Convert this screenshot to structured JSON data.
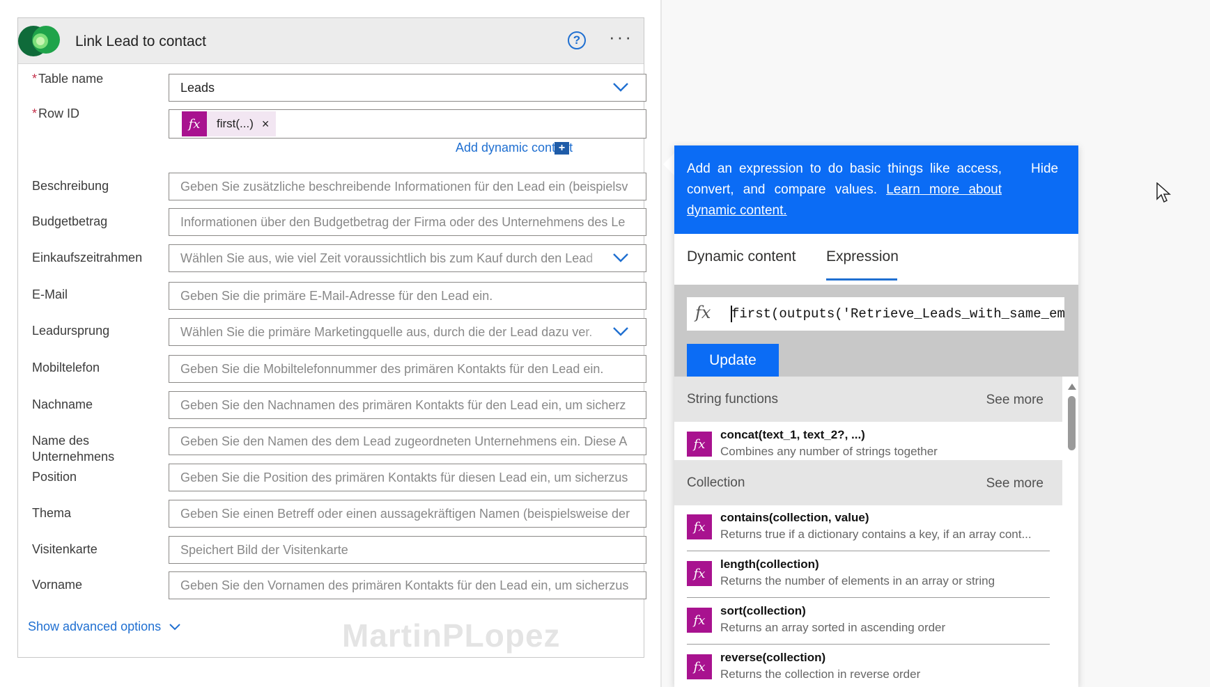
{
  "card": {
    "title": "Link Lead to contact",
    "help_icon": "help-circle-icon",
    "more_icon": "more-ellipsis-icon"
  },
  "fields": {
    "table_name": {
      "label": "Table name",
      "value": "Leads"
    },
    "row_id": {
      "label": "Row ID",
      "token": "first(...)",
      "token_close": "×"
    },
    "add_dynamic": {
      "label": "Add dynamic content",
      "icon": "+"
    },
    "beschreibung": {
      "label": "Beschreibung",
      "placeholder": "Geben Sie zusätzliche beschreibende Informationen für den Lead ein (beispielsv"
    },
    "budgetbetrag": {
      "label": "Budgetbetrag",
      "placeholder": "Informationen über den Budgetbetrag der Firma oder des Unternehmens des Le"
    },
    "einkaufszeitrahmen": {
      "label": "Einkaufszeitrahmen",
      "placeholder": "Wählen Sie aus, wie viel Zeit voraussichtlich bis zum Kauf durch den Lead"
    },
    "email": {
      "label": "E-Mail",
      "placeholder": "Geben Sie die primäre E-Mail-Adresse für den Lead ein."
    },
    "leadursprung": {
      "label": "Leadursprung",
      "placeholder": "Wählen Sie die primäre Marketingquelle aus, durch die der Lead dazu ver."
    },
    "mobiltelefon": {
      "label": "Mobiltelefon",
      "placeholder": "Geben Sie die Mobiltelefonnummer des primären Kontakts für den Lead ein."
    },
    "nachname": {
      "label": "Nachname",
      "placeholder": "Geben Sie den Nachnamen des primären Kontakts für den Lead ein, um sicherz"
    },
    "name_des_unternehmens": {
      "label": "Name des Unternehmens",
      "placeholder": "Geben Sie den Namen des dem Lead zugeordneten Unternehmens ein. Diese A"
    },
    "position": {
      "label": "Position",
      "placeholder": "Geben Sie die Position des primären Kontakts für diesen Lead ein, um sicherzus"
    },
    "thema": {
      "label": "Thema",
      "placeholder": "Geben Sie einen Betreff oder einen aussagekräftigen Namen (beispielsweise der"
    },
    "visitenkarte": {
      "label": "Visitenkarte",
      "placeholder": "Speichert Bild der Visitenkarte"
    },
    "vorname": {
      "label": "Vorname",
      "placeholder": "Geben Sie den Vornamen des primären Kontakts für den Lead ein, um sicherzus"
    }
  },
  "show_advanced": "Show advanced options",
  "watermark": "MartinPLopez",
  "panel": {
    "info_text": "Add an expression to do basic things like access, convert, and compare values.",
    "info_link": "Learn more about dynamic content.",
    "hide_label": "Hide",
    "tabs": [
      "Dynamic content",
      "Expression"
    ],
    "active_tab": "Expression",
    "expression_value": "first(outputs('Retrieve_Leads_with_same_em",
    "update_label": "Update",
    "sections": [
      {
        "title": "String functions",
        "see_more": "See more",
        "items": [
          {
            "name": "concat(text_1, text_2?, ...)",
            "desc": "Combines any number of strings together"
          }
        ]
      },
      {
        "title": "Collection",
        "see_more": "See more",
        "items": [
          {
            "name": "contains(collection, value)",
            "desc": "Returns true if a dictionary contains a key, if an array cont..."
          },
          {
            "name": "length(collection)",
            "desc": "Returns the number of elements in an array or string"
          },
          {
            "name": "sort(collection)",
            "desc": "Returns an array sorted in ascending order"
          },
          {
            "name": "reverse(collection)",
            "desc": "Returns the collection in reverse order"
          }
        ]
      }
    ]
  },
  "colors": {
    "accent": "#0b6cf5",
    "link": "#1f6fd1",
    "fx_token": "#a8128f",
    "required": "#c4314b"
  }
}
